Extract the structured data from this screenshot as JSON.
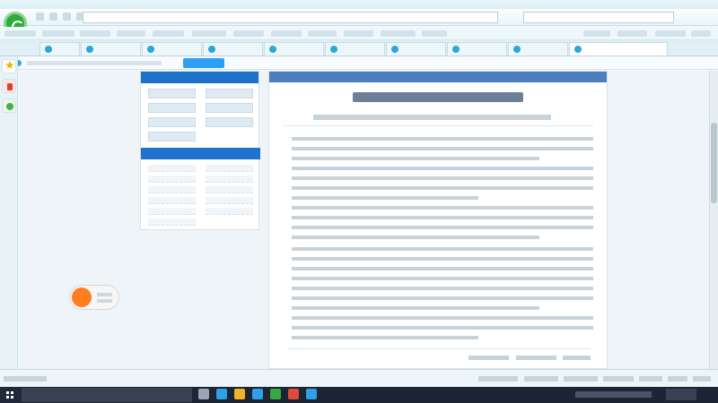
{
  "page": {}
}
